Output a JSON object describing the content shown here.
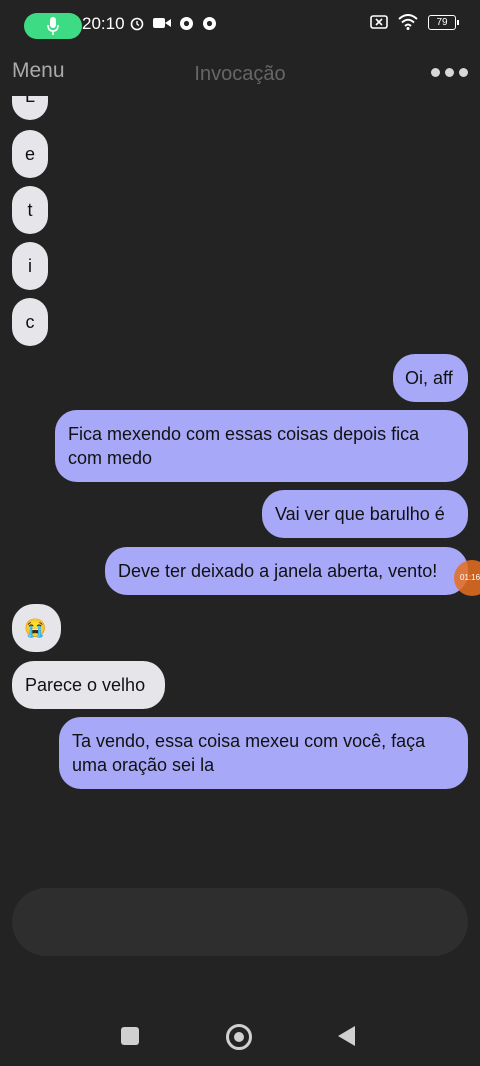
{
  "status": {
    "time": "20:10",
    "battery": "79"
  },
  "header": {
    "menu_label": "Menu",
    "title": "Invocação"
  },
  "messages": {
    "letters": [
      "L",
      "e",
      "t",
      "i",
      "c"
    ],
    "m1": "Oi, aff",
    "m2": "Fica mexendo com essas coisas depois fica com medo",
    "m3": "Vai ver que barulho é",
    "m4": "Deve ter deixado a janela aberta, vento!",
    "m5": "😭",
    "m6": "Parece o velho",
    "m7": "Ta vendo, essa coisa mexeu com você, faça uma oração sei la"
  },
  "overlay": {
    "text": "01:16"
  },
  "colors": {
    "outgoing": "#a8a8f8",
    "incoming": "#e5e5ea",
    "background": "#232323",
    "mic": "#3ddc84"
  }
}
